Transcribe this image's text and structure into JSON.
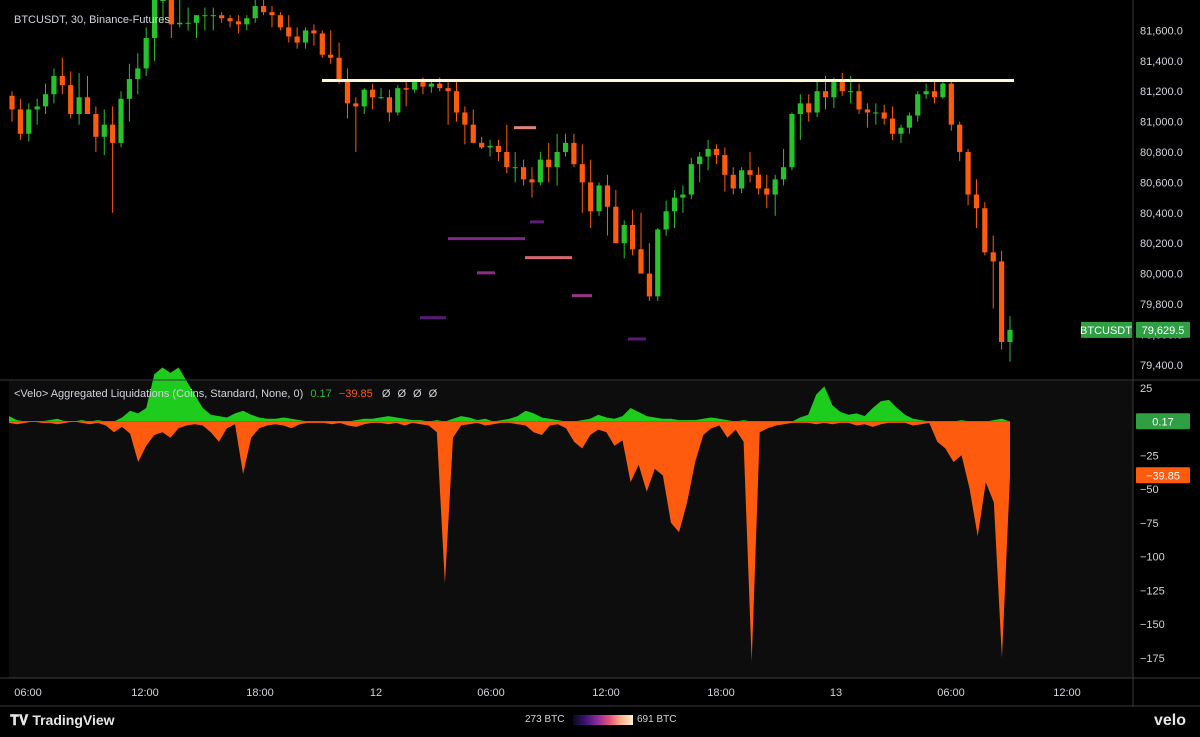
{
  "chart_data": [
    {
      "type": "candlestick",
      "symbol_label": "BTCUSDT, 30, Binance-Futures",
      "price_tag_label": "BTCUSDT",
      "last_price": 79629.5,
      "last_price_label": "79,629.5",
      "ylim": [
        79300,
        81800
      ],
      "y_ticks": [
        79400,
        79600,
        79800,
        80000,
        80200,
        80400,
        80600,
        80800,
        81000,
        81200,
        81400,
        81600
      ],
      "y_tick_labels": [
        "79,400.0",
        "79,600.0",
        "79,800.0",
        "80,000.0",
        "80,200.0",
        "80,400.0",
        "80,600.0",
        "80,800.0",
        "81,000.0",
        "81,200.0",
        "81,400.0",
        "81,600.0"
      ],
      "resistance_level": 81270,
      "colors": {
        "up": "#26c22b",
        "down": "#ff5b0f",
        "level": "#fff8d8",
        "tag_bg": "#2ea043"
      },
      "candles": [
        [
          81170,
          81200,
          81000,
          81080
        ],
        [
          81080,
          81150,
          80880,
          80920
        ],
        [
          80920,
          81120,
          80870,
          81080
        ],
        [
          81080,
          81150,
          80980,
          81100
        ],
        [
          81100,
          81250,
          81050,
          81180
        ],
        [
          81180,
          81350,
          81120,
          81300
        ],
        [
          81300,
          81420,
          81180,
          81240
        ],
        [
          81240,
          81330,
          81020,
          81050
        ],
        [
          81050,
          81320,
          80980,
          81160
        ],
        [
          81160,
          81300,
          81050,
          81050
        ],
        [
          81050,
          81100,
          80800,
          80900
        ],
        [
          80900,
          81080,
          80780,
          80980
        ],
        [
          80980,
          81100,
          80400,
          80860
        ],
        [
          80860,
          81200,
          80830,
          81150
        ],
        [
          81150,
          81380,
          81000,
          81280
        ],
        [
          81280,
          81450,
          81180,
          81350
        ],
        [
          81350,
          81620,
          81300,
          81550
        ],
        [
          81550,
          81800,
          81400,
          81800
        ],
        [
          81800,
          81900,
          81650,
          81800
        ],
        [
          81800,
          81860,
          81550,
          81640
        ],
        [
          81640,
          81820,
          81620,
          81650
        ],
        [
          81650,
          81750,
          81600,
          81650
        ],
        [
          81650,
          81700,
          81550,
          81700
        ],
        [
          81700,
          81750,
          81600,
          81700
        ],
        [
          81700,
          81750,
          81600,
          81700
        ],
        [
          81700,
          81720,
          81650,
          81680
        ],
        [
          81680,
          81700,
          81620,
          81660
        ],
        [
          81660,
          81700,
          81580,
          81640
        ],
        [
          81640,
          81700,
          81600,
          81680
        ],
        [
          81680,
          81800,
          81650,
          81760
        ],
        [
          81760,
          81820,
          81700,
          81720
        ],
        [
          81720,
          81760,
          81620,
          81700
        ],
        [
          81700,
          81720,
          81600,
          81620
        ],
        [
          81620,
          81700,
          81520,
          81560
        ],
        [
          81560,
          81620,
          81480,
          81520
        ],
        [
          81520,
          81620,
          81480,
          81600
        ],
        [
          81600,
          81640,
          81500,
          81580
        ],
        [
          81580,
          81600,
          81420,
          81440
        ],
        [
          81440,
          81600,
          81380,
          81420
        ],
        [
          81420,
          81520,
          81250,
          81280
        ],
        [
          81280,
          81350,
          81020,
          81120
        ],
        [
          81120,
          81160,
          80800,
          81100
        ],
        [
          81100,
          81220,
          81050,
          81210
        ],
        [
          81210,
          81250,
          81080,
          81160
        ],
        [
          81160,
          81220,
          81150,
          81160
        ],
        [
          81160,
          81210,
          81000,
          81060
        ],
        [
          81060,
          81240,
          81040,
          81220
        ],
        [
          81220,
          81280,
          81100,
          81210
        ],
        [
          81210,
          81280,
          81190,
          81260
        ],
        [
          81260,
          81290,
          81180,
          81230
        ],
        [
          81230,
          81280,
          81190,
          81250
        ],
        [
          81250,
          81290,
          81200,
          81220
        ],
        [
          81220,
          81260,
          80980,
          81200
        ],
        [
          81200,
          81260,
          81000,
          81060
        ],
        [
          81060,
          81100,
          80850,
          80980
        ],
        [
          80980,
          81080,
          80940,
          80860
        ],
        [
          80860,
          80900,
          80820,
          80830
        ],
        [
          80830,
          80880,
          80770,
          80840
        ],
        [
          80840,
          80880,
          80740,
          80800
        ],
        [
          80800,
          80980,
          80660,
          80700
        ],
        [
          80700,
          80800,
          80600,
          80700
        ],
        [
          80700,
          80750,
          80580,
          80620
        ],
        [
          80620,
          80700,
          80500,
          80600
        ],
        [
          80600,
          80800,
          80580,
          80750
        ],
        [
          80750,
          80860,
          80600,
          80700
        ],
        [
          80700,
          80920,
          80580,
          80800
        ],
        [
          80800,
          80920,
          80770,
          80860
        ],
        [
          80860,
          80920,
          80700,
          80720
        ],
        [
          80720,
          80850,
          80400,
          80600
        ],
        [
          80600,
          80750,
          80300,
          80410
        ],
        [
          80410,
          80600,
          80380,
          80580
        ],
        [
          80580,
          80650,
          80250,
          80440
        ],
        [
          80440,
          80550,
          80230,
          80200
        ],
        [
          80200,
          80350,
          80100,
          80320
        ],
        [
          80320,
          80420,
          80120,
          80160
        ],
        [
          80160,
          80400,
          80020,
          80000
        ],
        [
          80000,
          80200,
          79820,
          79850
        ],
        [
          79850,
          80300,
          79820,
          80290
        ],
        [
          80290,
          80480,
          80250,
          80410
        ],
        [
          80410,
          80550,
          80300,
          80500
        ],
        [
          80500,
          80580,
          80400,
          80520
        ],
        [
          80520,
          80760,
          80490,
          80720
        ],
        [
          80720,
          80800,
          80600,
          80770
        ],
        [
          80770,
          80880,
          80680,
          80820
        ],
        [
          80820,
          80850,
          80720,
          80780
        ],
        [
          80780,
          80830,
          80540,
          80650
        ],
        [
          80650,
          80700,
          80520,
          80560
        ],
        [
          80560,
          80700,
          80530,
          80680
        ],
        [
          80680,
          80800,
          80600,
          80650
        ],
        [
          80650,
          80700,
          80520,
          80560
        ],
        [
          80560,
          80650,
          80430,
          80520
        ],
        [
          80520,
          80650,
          80380,
          80620
        ],
        [
          80620,
          80820,
          80580,
          80700
        ],
        [
          80700,
          81060,
          80680,
          81050
        ],
        [
          81050,
          81180,
          80880,
          81120
        ],
        [
          81120,
          81180,
          81000,
          81060
        ],
        [
          81060,
          81270,
          81030,
          81200
        ],
        [
          81200,
          81300,
          81080,
          81160
        ],
        [
          81160,
          81290,
          81090,
          81260
        ],
        [
          81260,
          81320,
          81170,
          81200
        ],
        [
          81200,
          81300,
          81120,
          81200
        ],
        [
          81200,
          81250,
          81050,
          81080
        ],
        [
          81080,
          81120,
          80960,
          81060
        ],
        [
          81060,
          81120,
          80980,
          81060
        ],
        [
          81060,
          81110,
          80980,
          81020
        ],
        [
          81020,
          81100,
          80880,
          80920
        ],
        [
          80920,
          80980,
          80860,
          80960
        ],
        [
          80960,
          81060,
          80920,
          81040
        ],
        [
          81040,
          81200,
          81000,
          81180
        ],
        [
          81180,
          81250,
          81150,
          81200
        ],
        [
          81200,
          81270,
          81120,
          81160
        ],
        [
          81160,
          81280,
          81150,
          81250
        ],
        [
          81250,
          81270,
          80940,
          80980
        ],
        [
          80980,
          81000,
          80740,
          80800
        ],
        [
          80800,
          80820,
          80450,
          80520
        ],
        [
          80520,
          80620,
          80300,
          80430
        ],
        [
          80430,
          80470,
          80120,
          80140
        ],
        [
          80140,
          80250,
          79770,
          80080
        ],
        [
          80080,
          80150,
          79500,
          79550
        ],
        [
          79550,
          79720,
          79420,
          79630
        ]
      ],
      "liq_bands": [
        {
          "price": 80230,
          "x0": 448,
          "x1": 525,
          "intensity": 0.35
        },
        {
          "price": 80105,
          "x0": 525,
          "x1": 572,
          "intensity": 0.8
        },
        {
          "price": 80005,
          "x0": 477,
          "x1": 495,
          "intensity": 0.4
        },
        {
          "price": 79855,
          "x0": 572,
          "x1": 592,
          "intensity": 0.45
        },
        {
          "price": 79710,
          "x0": 420,
          "x1": 446,
          "intensity": 0.15
        },
        {
          "price": 81270,
          "x0": 395,
          "x1": 418,
          "intensity": 0.45
        },
        {
          "price": 81270,
          "x0": 792,
          "x1": 804,
          "intensity": 0.85
        },
        {
          "price": 81270,
          "x0": 897,
          "x1": 910,
          "intensity": 0.7
        },
        {
          "price": 80960,
          "x0": 514,
          "x1": 536,
          "intensity": 0.9
        },
        {
          "price": 80340,
          "x0": 530,
          "x1": 544,
          "intensity": 0.2
        },
        {
          "price": 79570,
          "x0": 628,
          "x1": 646,
          "intensity": 0.15
        }
      ]
    },
    {
      "type": "area",
      "title": "<Velo> Aggregated Liquidations (Coins, Standard, None, 0)",
      "value_long": "0.17",
      "value_short": "−39.85",
      "value_placeholders": "Ø Ø Ø Ø",
      "ylim": [
        -190,
        30
      ],
      "y_ticks": [
        25,
        -25,
        -50,
        -75,
        -100,
        -125,
        -150,
        -175
      ],
      "y_tick_labels": [
        "25",
        "−25",
        "−50",
        "−75",
        "−100",
        "−125",
        "−150",
        "−175"
      ],
      "tags": [
        {
          "value": 0.17,
          "label": "0.17",
          "color": "#2ea043"
        },
        {
          "value": -39.85,
          "label": "−39.85",
          "color": "#ff5b0f"
        }
      ],
      "series": [
        {
          "values": [
            4,
            1,
            0,
            0,
            0,
            1,
            2,
            0,
            0,
            1,
            0,
            1,
            0,
            0,
            3,
            8,
            6,
            10,
            35,
            40,
            36,
            40,
            30,
            20,
            10,
            5,
            4,
            3,
            6,
            8,
            5,
            3,
            2,
            2,
            3,
            2,
            1,
            0,
            0,
            0,
            0,
            0,
            0,
            1,
            2,
            2,
            3,
            4,
            3,
            2,
            1,
            1,
            0,
            1,
            0,
            2,
            4,
            3,
            1,
            2,
            0,
            1,
            2,
            4,
            8,
            6,
            3,
            2,
            1,
            0,
            0,
            1,
            2,
            5,
            3,
            2,
            4,
            10,
            7,
            4,
            3,
            2,
            2,
            1,
            1,
            1,
            2,
            3,
            2,
            1,
            0,
            1,
            0,
            0,
            0,
            0,
            0,
            0,
            3,
            5,
            20,
            26,
            12,
            7,
            5,
            6,
            4,
            10,
            15,
            16,
            10,
            5,
            2,
            1,
            0,
            0,
            0,
            0,
            1,
            0,
            0,
            0,
            1,
            2,
            0
          ]
        },
        {
          "values": [
            -1,
            -2,
            -1,
            0,
            -1,
            -1,
            -2,
            -1,
            0,
            -1,
            -2,
            -1,
            -3,
            -8,
            -4,
            -9,
            -30,
            -18,
            -10,
            -8,
            -12,
            -5,
            -3,
            -2,
            -3,
            -8,
            -15,
            -5,
            -2,
            -39,
            -12,
            -5,
            -3,
            -2,
            -3,
            -5,
            -2,
            -1,
            -1,
            -1,
            -2,
            -1,
            -3,
            -4,
            -2,
            -1,
            -1,
            -2,
            -1,
            -3,
            -1,
            -2,
            -3,
            -8,
            -120,
            -12,
            -3,
            -2,
            -1,
            -3,
            -2,
            -1,
            -1,
            -2,
            -3,
            -8,
            -10,
            -3,
            -2,
            -5,
            -15,
            -20,
            -10,
            -6,
            -8,
            -18,
            -14,
            -45,
            -32,
            -52,
            -35,
            -40,
            -75,
            -82,
            -60,
            -30,
            -10,
            -5,
            -3,
            -12,
            -6,
            -15,
            -178,
            -8,
            -5,
            -3,
            -2,
            -1,
            -1,
            -1,
            -2,
            -1,
            -2,
            -1,
            -1,
            -3,
            -2,
            -4,
            -2,
            -1,
            -1,
            -1,
            -3,
            -2,
            -1,
            -15,
            -20,
            -30,
            -25,
            -50,
            -85,
            -45,
            -60,
            -175,
            -40
          ]
        }
      ],
      "colors": {
        "positive": "#1ecc1e",
        "negative": "#ff5b0f"
      }
    }
  ],
  "time_axis": {
    "labels": [
      "06:00",
      "12:00",
      "18:00",
      "12",
      "06:00",
      "12:00",
      "18:00",
      "13",
      "06:00",
      "12:00"
    ]
  },
  "footer": {
    "brand": "TradingView",
    "legend_min": "273 BTC",
    "legend_max": "691 BTC",
    "corner_brand": "velo"
  }
}
